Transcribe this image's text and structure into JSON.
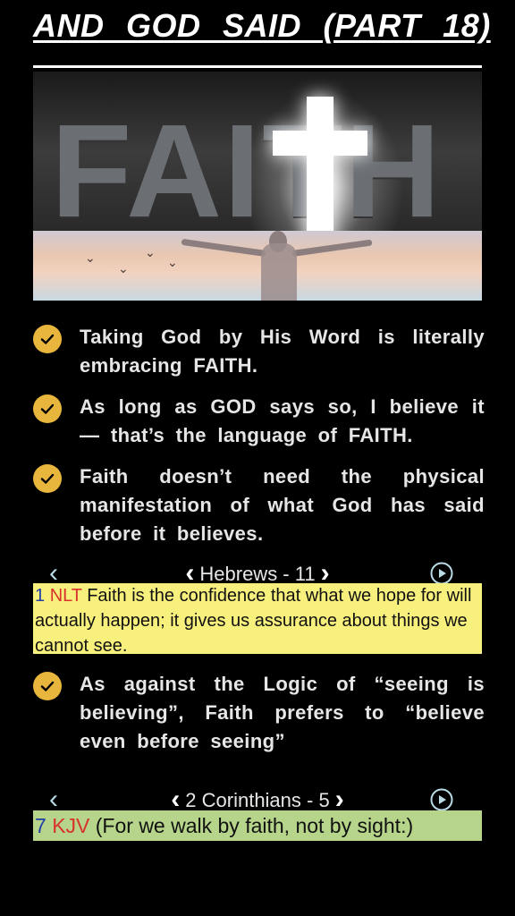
{
  "header": {
    "title": "AND  GOD  SAID  (PART 18)"
  },
  "banner": {
    "word": "FAITH"
  },
  "bullets": [
    {
      "text": "Taking God by His Word is literally embracing FAITH."
    },
    {
      "text": "As long as GOD says so, I believe it — that’s the language of FAITH."
    },
    {
      "text": "Faith doesn’t need the physical manifestation of what God has said before it believes."
    },
    {
      "text": "As against the Logic of “seeing is believing”, Faith prefers to “believe even before seeing”"
    }
  ],
  "scripture_1": {
    "book_label": "Hebrews - 11",
    "verse_number": "1",
    "translation": "NLT",
    "text": "Faith is the confidence that what we hope for will actually happen; it gives us assurance about things we cannot see."
  },
  "scripture_2": {
    "book_label": "2 Corinthians - 5",
    "verse_number": "7",
    "translation": "KJV",
    "text": "(For we walk by faith, not by sight:)"
  },
  "colors": {
    "check": "#e8b63c",
    "nlt_highlight": "#f8f07d",
    "kjv_highlight": "#b6d58a",
    "verse_number": "#1f3fa6",
    "translation": "#d8322a"
  },
  "icons": [
    "check-circle-icon",
    "back-chevron-icon",
    "prev-chapter-icon",
    "next-chapter-icon",
    "play-circle-icon"
  ]
}
